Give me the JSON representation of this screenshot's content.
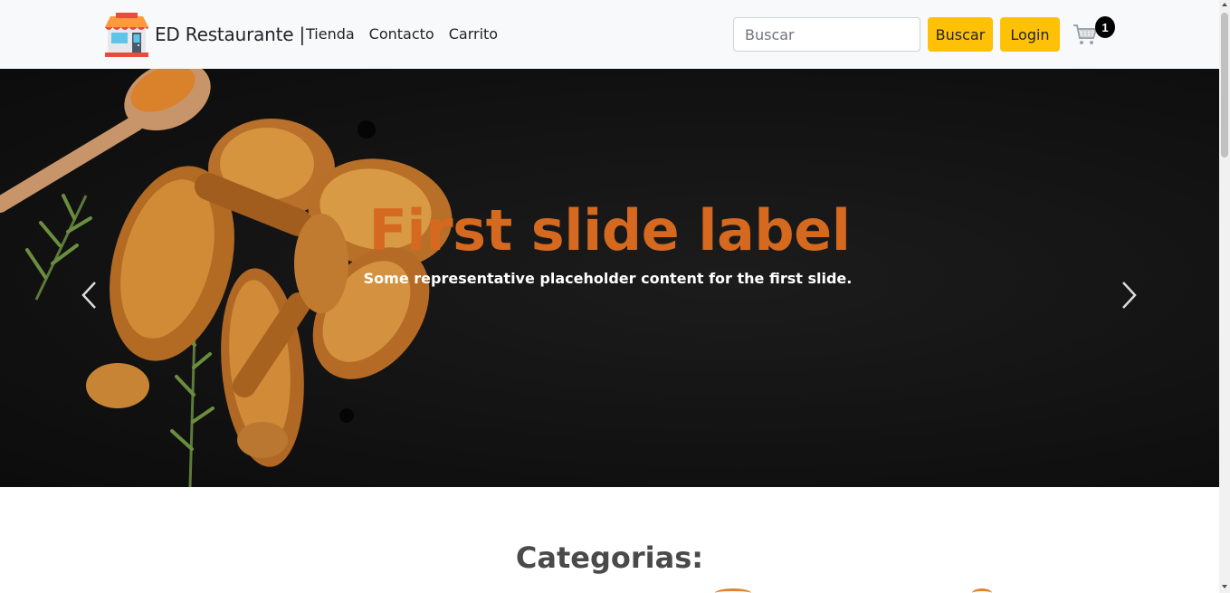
{
  "navbar": {
    "brand_name": "ED Restaurante |",
    "logo_icon": "storefront-icon",
    "links": [
      {
        "label": "Tienda"
      },
      {
        "label": "Contacto"
      },
      {
        "label": "Carrito"
      }
    ],
    "search": {
      "placeholder": "Buscar",
      "value": ""
    },
    "search_button": "Buscar",
    "login_button": "Login",
    "cart_icon": "shopping-cart-icon",
    "cart_count": "1"
  },
  "carousel": {
    "title": "First slide label",
    "text": "Some representative placeholder content for the first slide.",
    "prev_icon": "chevron-left-icon",
    "next_icon": "chevron-right-icon",
    "title_color": "#d4691f"
  },
  "categories": {
    "heading": "Categorias:"
  },
  "colors": {
    "accent": "#ffc107",
    "navbar_bg": "#f8f9fa",
    "heading": "#4a4a4a"
  }
}
